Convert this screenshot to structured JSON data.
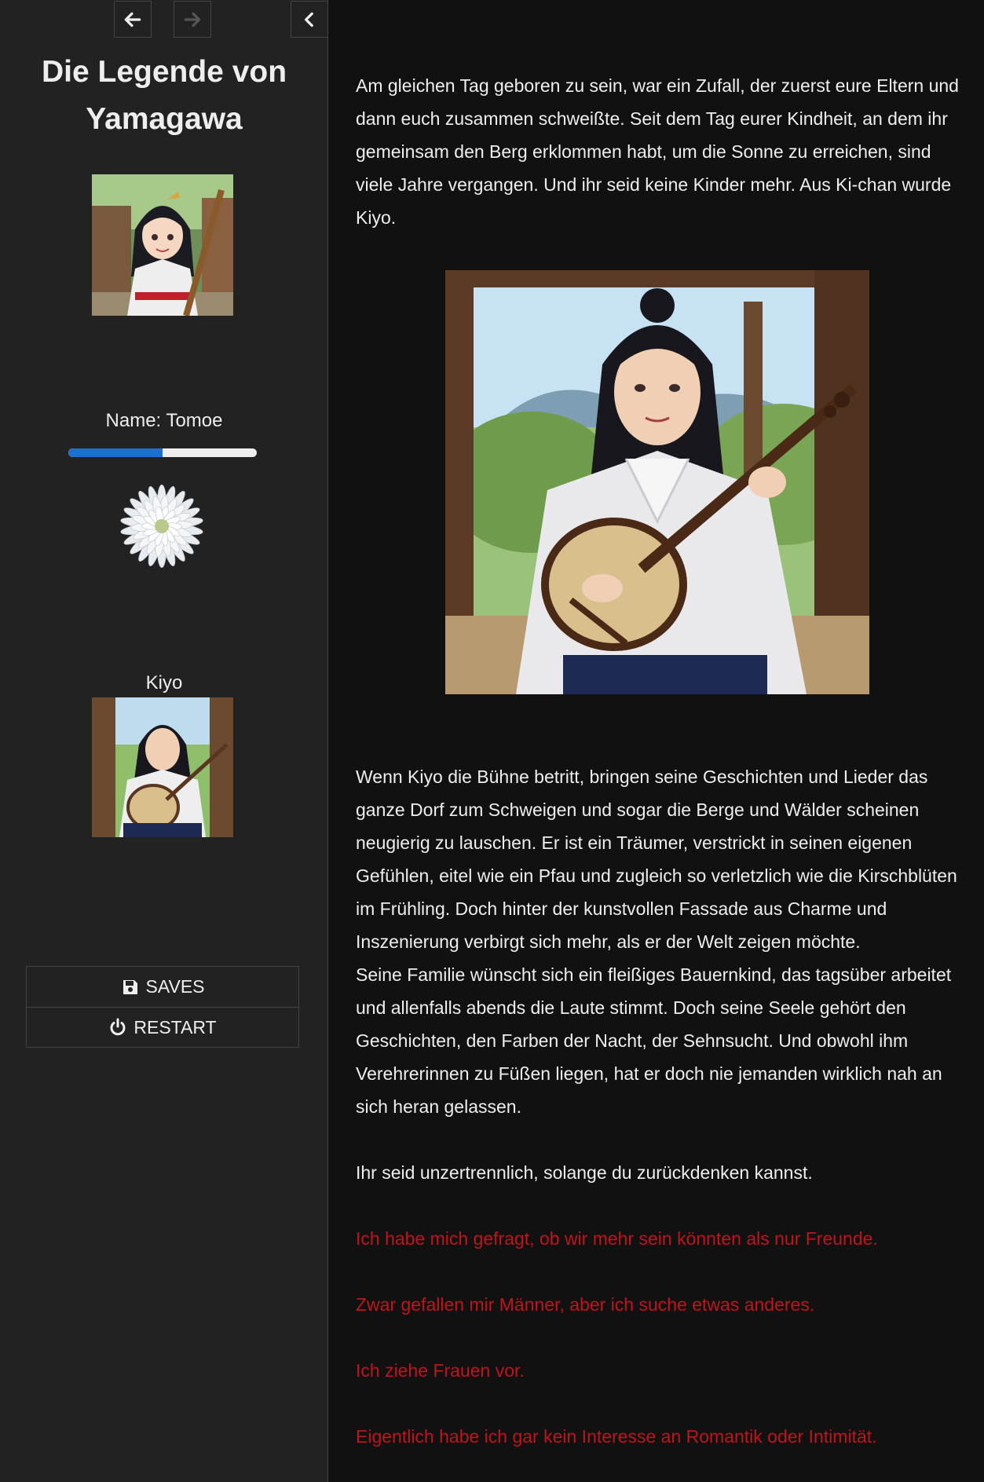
{
  "nav": {
    "back_icon": "arrow-left-icon",
    "forward_icon": "arrow-right-icon",
    "stow_icon": "chevron-left-icon"
  },
  "sidebar": {
    "title": "Die Legende von Yamagawa",
    "name_label": "Name: Tomoe",
    "progress": 0.5,
    "progress_color": "#1f6fd1",
    "flower_icon": "white-chrysanthemum-icon",
    "npc_name": "Kiyo",
    "menu": {
      "saves_label": "SAVES",
      "saves_icon": "floppy-disk-icon",
      "restart_label": "RESTART",
      "restart_icon": "power-icon"
    }
  },
  "passage": {
    "paragraph_1": "Am gleichen Tag geboren zu sein, war ein Zufall, der zuerst eure Eltern und dann euch zusammen schweißte. Seit dem Tag eurer Kindheit, an dem ihr gemeinsam den Berg erklommen habt, um die Sonne zu erreichen, sind viele Jahre vergangen. Und ihr seid keine Kinder mehr. Aus Ki-chan wurde Kiyo.",
    "paragraph_2": "Wenn Kiyo die Bühne betritt, bringen seine Geschichten und Lieder das ganze Dorf zum Schweigen und sogar die Berge und Wälder scheinen neugierig zu lauschen. Er ist ein Träumer, verstrickt in seinen eigenen Gefühlen, eitel wie ein Pfau und zugleich so verletzlich wie die Kirschblüten im Frühling. Doch hinter der kunstvollen Fassade aus Charme und Inszenierung verbirgt sich mehr, als er der Welt zeigen möchte.",
    "paragraph_3": "Seine Familie wünscht sich ein fleißiges Bauernkind, das tagsüber arbeitet und allenfalls abends die Laute stimmt. Doch seine Seele gehört den Geschichten, den Farben der Nacht, der Sehnsucht. Und obwohl ihm Verehrerinnen zu Füßen liegen, hat er doch nie jemanden wirklich nah an sich heran gelassen.",
    "paragraph_4": "Ihr seid unzertrennlich, solange du zurückdenken kannst.",
    "choices": [
      "Ich habe mich gefragt, ob wir mehr sein könnten als nur Freunde.",
      "Zwar gefallen mir Männer, aber ich suche etwas anderes.",
      "Ich ziehe Frauen vor.",
      "Eigentlich habe ich gar kein Interesse an Romantik oder Intimität."
    ],
    "choice_color": "#c0151d"
  }
}
